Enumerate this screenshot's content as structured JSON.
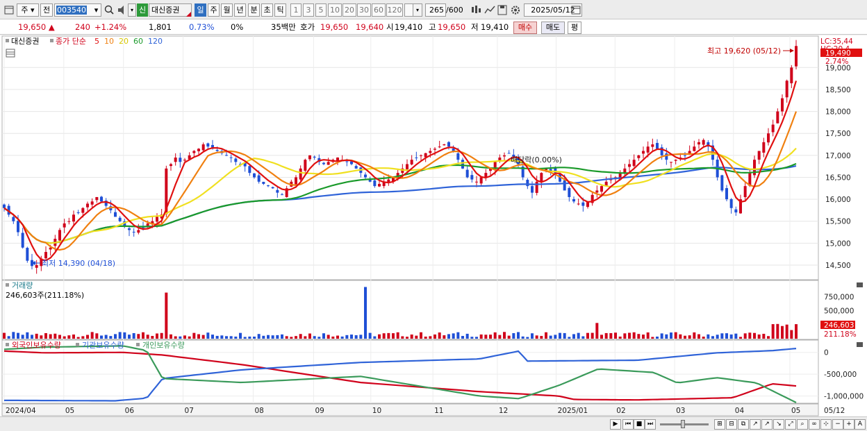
{
  "toolbar": {
    "period_type": "주",
    "prev_label": "전",
    "code": "003540",
    "stock_badge": "신",
    "stock_name": "대신증권",
    "tabs": [
      "일",
      "주",
      "월",
      "년",
      "분",
      "초",
      "틱"
    ],
    "active_tab": "일",
    "numbers": [
      "1",
      "3",
      "5",
      "10",
      "20",
      "30",
      "60",
      "120"
    ],
    "count": "265",
    "total": "/600",
    "date": "2025/05/12"
  },
  "info": {
    "price": "19,650",
    "change": "240",
    "change_pct": "+1.24%",
    "volume": "1,801",
    "vol_pct": "0.73%",
    "pct0": "0%",
    "amount": "35백만",
    "quote_label": "호가",
    "ask": "19,650",
    "bid": "19,640",
    "open_label": "시",
    "open": "19,410",
    "high_label": "고",
    "high": "19,650",
    "low_label": "저",
    "low": "19,410",
    "buy_label": "매수",
    "sell_label": "매도",
    "flat_label": "평"
  },
  "legend": {
    "name": "대신증권",
    "ma_label": "종가 단순",
    "ma_items": [
      {
        "label": "5",
        "color": "#e01010"
      },
      {
        "label": "10",
        "color": "#f08010"
      },
      {
        "label": "20",
        "color": "#f0e020"
      },
      {
        "label": "60",
        "color": "#1a9a2a"
      },
      {
        "label": "120",
        "color": "#2f63d8"
      }
    ]
  },
  "price_panel": {
    "lc_label": "LC:35,44",
    "hc_label": "HC:20,4",
    "current_price": "19,490",
    "current_pct": "2.74%",
    "max_label": "최고 19,620 (05/12)",
    "min_label": "최저 14,390 (04/18)",
    "dividend_label": "배당락(0.00%)",
    "y_ticks": [
      "19,000",
      "18,500",
      "18,000",
      "17,500",
      "17,000",
      "16,500",
      "16,000",
      "15,500",
      "15,000",
      "14,500"
    ]
  },
  "volume_panel": {
    "title": "거래량",
    "value_label": "246,603주(211.18%)",
    "y_ticks": [
      "750,000",
      "500,000"
    ],
    "current": "246,603",
    "current_pct": "211.18%"
  },
  "holdings_panel": {
    "items": [
      {
        "label": "외국인보유수량",
        "color": "#d0021b"
      },
      {
        "label": "기관보유수량",
        "color": "#2f63d8"
      },
      {
        "label": "개인보유수량",
        "color": "#3a9a5a"
      }
    ],
    "y_ticks": [
      "0",
      "-500,000",
      "-1,000,000"
    ]
  },
  "x_axis": [
    "2024/04",
    "05",
    "06",
    "07",
    "08",
    "09",
    "10",
    "11",
    "12",
    "2025/01",
    "02",
    "03",
    "04",
    "05",
    "05/12"
  ],
  "colors": {
    "up": "#d0021b",
    "down": "#1f4fd6",
    "ma5": "#e01010",
    "ma10": "#f08010",
    "ma20": "#f0e020",
    "ma60": "#1a9a2a",
    "ma120": "#2f63d8"
  },
  "chart_data": {
    "type": "candlestick",
    "closes": [
      15800,
      15650,
      15500,
      15250,
      14900,
      14600,
      14480,
      14500,
      14650,
      14800,
      14900,
      15100,
      15300,
      15450,
      15500,
      15650,
      15700,
      15800,
      15900,
      15950,
      16050,
      15950,
      15850,
      15750,
      15600,
      15500,
      15400,
      15300,
      15250,
      15300,
      15350,
      15450,
      15500,
      15600,
      15650,
      16700,
      16800,
      16950,
      16850,
      16900,
      17000,
      17100,
      17150,
      17250,
      17200,
      17150,
      17100,
      17050,
      17000,
      16950,
      16850,
      16800,
      16750,
      16600,
      16500,
      16400,
      16350,
      16300,
      16250,
      16150,
      16100,
      16250,
      16400,
      16500,
      16700,
      16900,
      17000,
      16950,
      16850,
      16800,
      16850,
      16900,
      16950,
      16900,
      16850,
      16800,
      16700,
      16600,
      16500,
      16400,
      16300,
      16350,
      16400,
      16450,
      16500,
      16600,
      16700,
      16800,
      16900,
      16950,
      17000,
      17050,
      17100,
      17150,
      17200,
      17250,
      17200,
      17100,
      16900,
      16700,
      16500,
      16450,
      16400,
      16500,
      16600,
      16700,
      16850,
      16950,
      17000,
      17050,
      16950,
      16800,
      16500,
      16300,
      16150,
      16400,
      16600,
      16700,
      16650,
      16600,
      16400,
      16200,
      16050,
      15950,
      15900,
      15850,
      15950,
      16100,
      16200,
      16300,
      16400,
      16450,
      16500,
      16600,
      16700,
      16800,
      16900,
      17000,
      17100,
      17200,
      17250,
      17150,
      17000,
      16900,
      16850,
      16900,
      16950,
      17000,
      17100,
      17200,
      17300,
      17350,
      17200,
      16900,
      16500,
      16200,
      16000,
      15800,
      15700,
      16000,
      16300,
      16600,
      16900,
      17100,
      17300,
      17500,
      17700,
      18000,
      18300,
      18700,
      19000,
      19490
    ],
    "ma_series": [
      "5",
      "10",
      "20",
      "60",
      "120"
    ],
    "price_range": [
      14200,
      19700
    ],
    "max": {
      "value": 19620,
      "date": "05/12"
    },
    "min": {
      "value": 14390,
      "date": "04/18"
    },
    "volume_range": [
      0,
      1000000
    ],
    "holdings_range": [
      -1150000,
      250000
    ]
  }
}
